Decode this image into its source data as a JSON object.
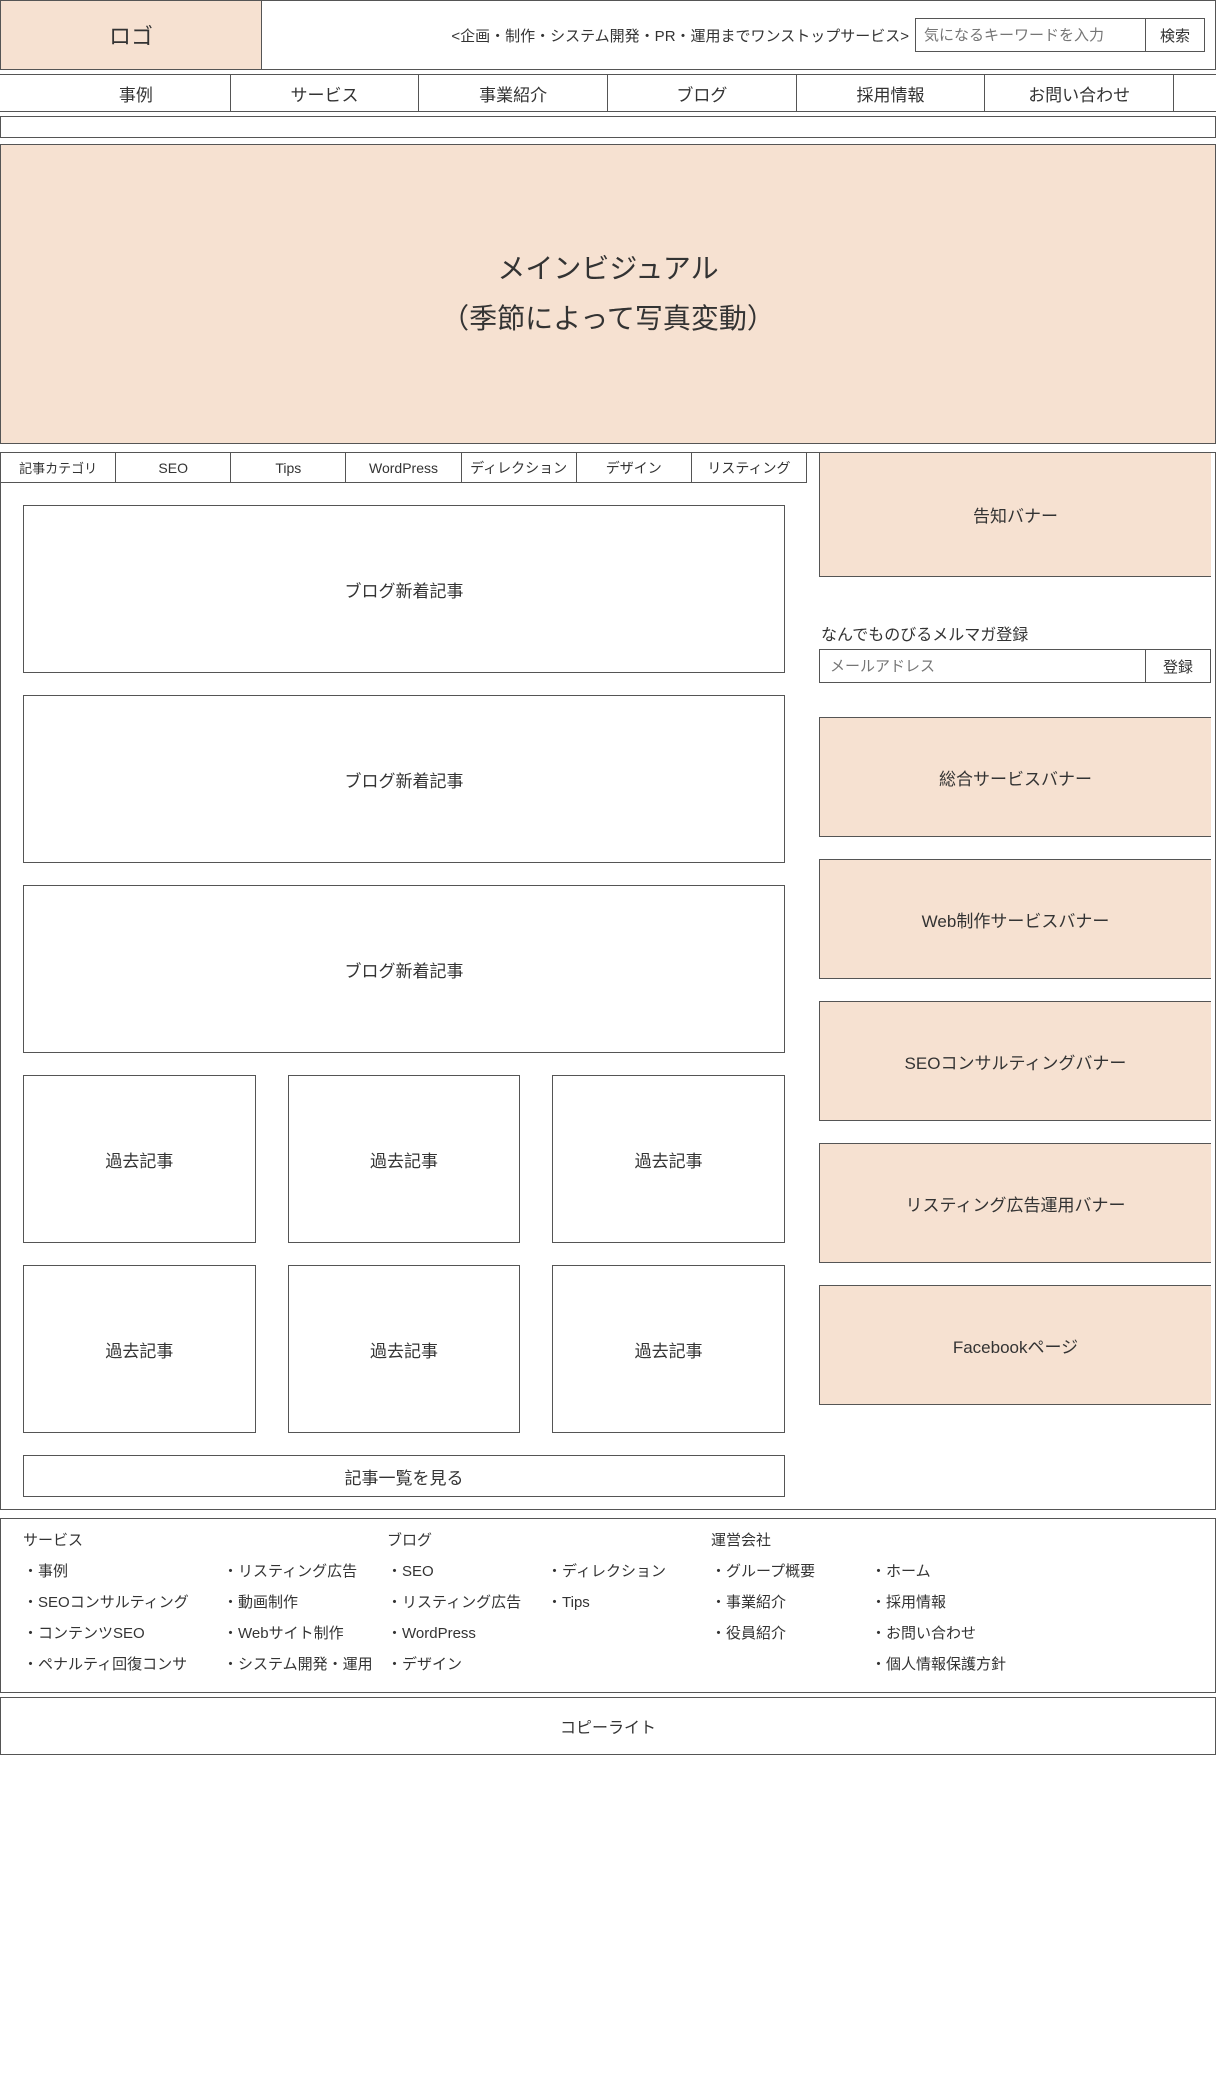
{
  "header": {
    "logo": "ロゴ",
    "tagline": "<企画・制作・システム開発・PR・運用までワンストップサービス>",
    "search_placeholder": "気になるキーワードを入力",
    "search_button": "検索"
  },
  "gnav": [
    "事例",
    "サービス",
    "事業紹介",
    "ブログ",
    "採用情報",
    "お問い合わせ"
  ],
  "mv": {
    "line1": "メインビジュアル",
    "line2": "（季節によって写真変動）"
  },
  "categories": {
    "label": "記事カテゴリ",
    "tabs": [
      "SEO",
      "Tips",
      "WordPress",
      "ディレクション",
      "デザイン",
      "リスティング"
    ]
  },
  "blog": {
    "new_articles": [
      "ブログ新着記事",
      "ブログ新着記事",
      "ブログ新着記事"
    ],
    "past_articles": [
      "過去記事",
      "過去記事",
      "過去記事",
      "過去記事",
      "過去記事",
      "過去記事"
    ],
    "more": "記事一覧を見る"
  },
  "sidebar": {
    "notice": "告知バナー",
    "mail_heading": "なんでものびるメルマガ登録",
    "mail_placeholder": "メールアドレス",
    "mail_button": "登録",
    "banners": [
      "総合サービスバナー",
      "Web制作サービスバナー",
      "SEOコンサルティングバナー",
      "リスティング広告運用バナー",
      "Facebookページ"
    ]
  },
  "footer": {
    "service_heading": "サービス",
    "service_col1": [
      "事例",
      "SEOコンサルティング",
      "コンテンツSEO",
      "ペナルティ回復コンサ"
    ],
    "service_col2": [
      "リスティング広告",
      "動画制作",
      "Webサイト制作",
      "システム開発・運用"
    ],
    "blog_heading": "ブログ",
    "blog_col1": [
      "SEO",
      "リスティング広告",
      "WordPress",
      "デザイン"
    ],
    "blog_col2": [
      "ディレクション",
      "Tips"
    ],
    "company_heading": "運営会社",
    "company_col1": [
      "グループ概要",
      "事業紹介",
      "役員紹介"
    ],
    "company_col2": [
      "ホーム",
      "採用情報",
      "お問い合わせ",
      "個人情報保護方針"
    ]
  },
  "copyright": "コピーライト"
}
